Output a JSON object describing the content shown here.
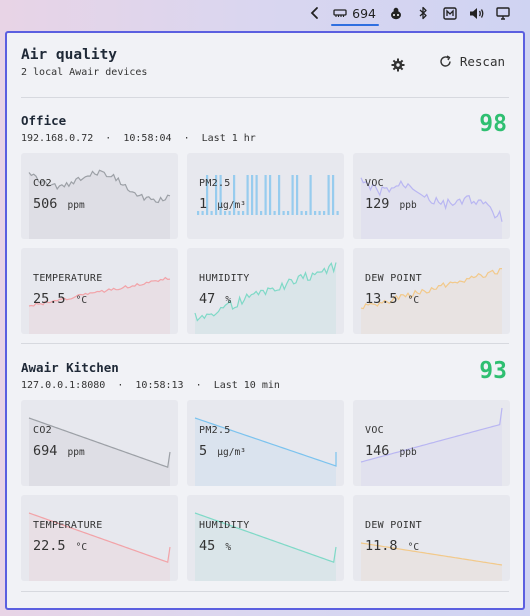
{
  "topbar": {
    "usage_count": "694",
    "icons": [
      "chevron-left-icon",
      "memory-icon",
      "bug-icon",
      "bluetooth-icon",
      "keyboard-icon",
      "volume-icon",
      "display-icon"
    ]
  },
  "header": {
    "title": "Air quality",
    "subtitle": "2 local Awair devices",
    "rescan_label": "Rescan"
  },
  "colors": {
    "score_green": "#2fbf71",
    "accent_border": "#5b5fe0",
    "co2": "#9ca0a6",
    "pm25": "#7cc3ee",
    "voc": "#b9b6f2",
    "temperature": "#f2a3a8",
    "humidity": "#7fd9c7",
    "dew_point": "#f2c98a"
  },
  "devices": [
    {
      "name": "Office",
      "address": "192.168.0.72",
      "time": "10:58:04",
      "range": "Last 1 hr",
      "score": "98",
      "metrics": [
        {
          "key": "co2",
          "label": "CO2",
          "value": "506",
          "unit": "ppm"
        },
        {
          "key": "pm25",
          "label": "PM2.5",
          "value": "1",
          "unit": "µg/m³"
        },
        {
          "key": "voc",
          "label": "VOC",
          "value": "129",
          "unit": "ppb"
        },
        {
          "key": "temperature",
          "label": "TEMPERATURE",
          "value": "25.5",
          "unit": "°C"
        },
        {
          "key": "humidity",
          "label": "HUMIDITY",
          "value": "47",
          "unit": "%"
        },
        {
          "key": "dew_point",
          "label": "DEW POINT",
          "value": "13.5",
          "unit": "°C"
        }
      ]
    },
    {
      "name": "Awair Kitchen",
      "address": "127.0.0.1:8080",
      "time": "10:58:13",
      "range": "Last 10 min",
      "score": "93",
      "metrics": [
        {
          "key": "co2",
          "label": "CO2",
          "value": "694",
          "unit": "ppm"
        },
        {
          "key": "pm25",
          "label": "PM2.5",
          "value": "5",
          "unit": "µg/m³"
        },
        {
          "key": "voc",
          "label": "VOC",
          "value": "146",
          "unit": "ppb"
        },
        {
          "key": "temperature",
          "label": "TEMPERATURE",
          "value": "22.5",
          "unit": "°C"
        },
        {
          "key": "humidity",
          "label": "HUMIDITY",
          "value": "45",
          "unit": "%"
        },
        {
          "key": "dew_point",
          "label": "DEW POINT",
          "value": "11.8",
          "unit": "°C"
        }
      ]
    }
  ]
}
